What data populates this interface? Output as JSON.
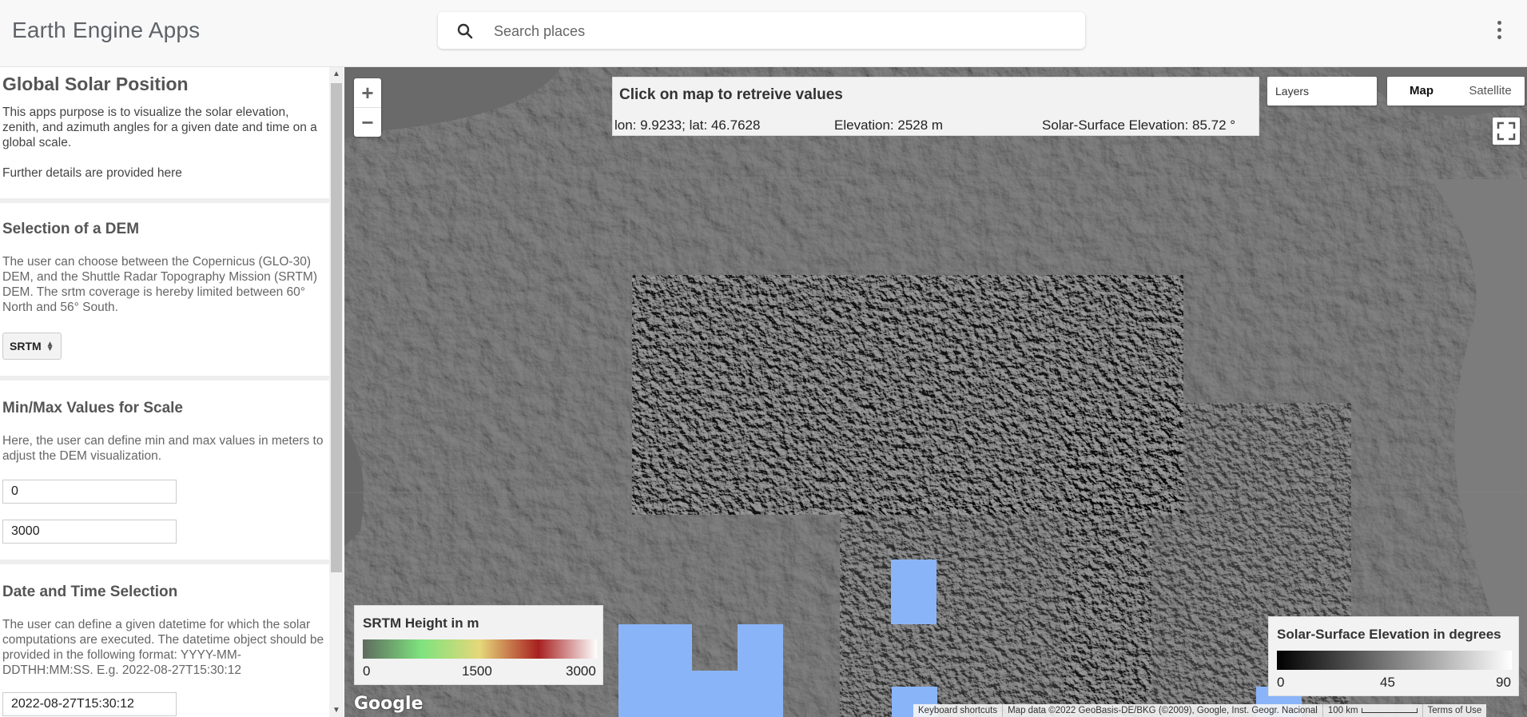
{
  "header": {
    "title": "Earth Engine Apps",
    "search_placeholder": "Search places"
  },
  "sidebar": {
    "intro": {
      "title": "Global Solar Position",
      "description": "This apps purpose is to visualize the solar elevation, zenith, and azimuth angles for a given date and time on a global scale.",
      "details": "Further details are provided here"
    },
    "dem": {
      "title": "Selection of a DEM",
      "description": "The user can choose between the Copernicus (GLO-30) DEM, and the Shuttle Radar Topography Mission (SRTM) DEM. The srtm coverage is hereby limited between 60° North and 56° South.",
      "selected": "SRTM"
    },
    "minmax": {
      "title": "Min/Max Values for Scale",
      "description": "Here, the user can define min and max values in meters to adjust the DEM visualization.",
      "min_value": "0",
      "max_value": "3000"
    },
    "datetime": {
      "title": "Date and Time Selection",
      "description": "The user can define a given datetime for which the solar computations are executed. The datetime object should be provided in the following format: YYYY-MM-DDTHH:MM:SS. E.g. 2022-08-27T15:30:12",
      "value": "2022-08-27T15:30:12"
    }
  },
  "map": {
    "zoom_in": "+",
    "zoom_out": "−",
    "info": {
      "title": "Click on map to retreive values",
      "coords": "lon: 9.9233; lat: 46.7628",
      "elevation": "Elevation: 2528 m",
      "solar": "Solar-Surface Elevation: 85.72 °"
    },
    "layers_label": "Layers",
    "map_type": {
      "map": "Map",
      "satellite": "Satellite"
    },
    "legend_dem": {
      "title": "SRTM Height in m",
      "ticks": [
        "0",
        "1500",
        "3000"
      ],
      "colors": [
        "#5f6b5f",
        "#7ee37e",
        "#e6d77a",
        "#a82020",
        "#ffffff"
      ]
    },
    "legend_solar": {
      "title": "Solar-Surface Elevation in degrees",
      "ticks": [
        "0",
        "45",
        "90"
      ],
      "colors": [
        "#000000",
        "#ffffff"
      ]
    },
    "google": "Google",
    "attribution": {
      "shortcuts": "Keyboard shortcuts",
      "data": "Map data ©2022 GeoBasis-DE/BKG (©2009), Google, Inst. Geogr. Nacional",
      "scale": "100 km",
      "terms": "Terms of Use"
    },
    "overlay_color": "#8ab4f8"
  }
}
